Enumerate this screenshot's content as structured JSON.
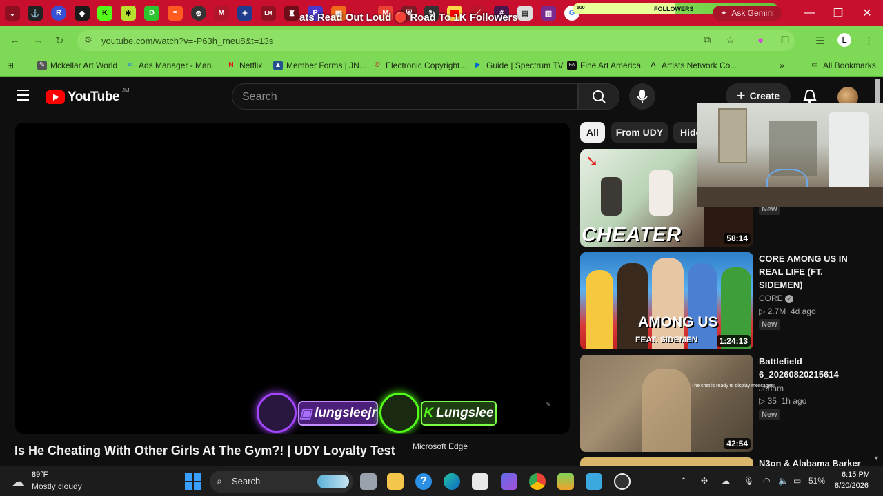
{
  "browser": {
    "overlay_title": "ats Read Out Loud 🔴 Road To 1K Followers",
    "followers_label": "FOLLOWERS",
    "followers_count": "500",
    "followers_progress": 0.5,
    "followers_small": "500",
    "ask_gemini": "Ask Gemini",
    "url": "youtube.com/watch?v=-P63h_rneu8&t=13s",
    "tab_icons": [
      "R",
      "K",
      "D",
      "M",
      "LM",
      "P",
      "M",
      "K"
    ]
  },
  "bookmarks": [
    {
      "label": "Mckellar Art World",
      "icon": "paint-icon"
    },
    {
      "label": "Ads Manager - Man...",
      "icon": "meta-icon"
    },
    {
      "label": "Netflix",
      "icon": "netflix-icon"
    },
    {
      "label": "Member Forms | JN...",
      "icon": "forms-icon"
    },
    {
      "label": "Electronic Copyright...",
      "icon": "copyright-icon"
    },
    {
      "label": "Guide | Spectrum TV",
      "icon": "play-icon"
    },
    {
      "label": "Fine Art America",
      "icon": "faa-icon"
    },
    {
      "label": "Artists Network Co...",
      "icon": "artists-icon"
    }
  ],
  "all_bookmarks": "All Bookmarks",
  "youtube": {
    "logo_text": "YouTube",
    "country": "JM",
    "search_placeholder": "Search",
    "create_label": "Create",
    "chips": [
      "All",
      "From UDY",
      "Hidde"
    ],
    "video_title": "Is He Cheating With Other Girls At The Gym?! | UDY Loyalty Test",
    "watermark_left": "lungsleejr",
    "watermark_right": "Lungslee",
    "recommendations": [
      {
        "thumb_text": "CHEATER",
        "duration": "58:14",
        "badge": "New"
      },
      {
        "title": "CORE AMONG US IN REAL LIFE (FT. SIDEMEN)",
        "channel": "CORE",
        "views": "2.7M",
        "age": "4d ago",
        "duration": "1:24:13",
        "thumb_text": "AMONG US",
        "thumb_sub": "FEAT. SIDEMEN",
        "badge": "New"
      },
      {
        "title": "Battlefield 6_20260820215614",
        "channel": "Jeriam",
        "views": "35",
        "age": "1h ago",
        "duration": "42:54",
        "chat_notice": "The chat is ready to display messages!",
        "badge": "New"
      },
      {
        "title": "N3on & Alabama Barker"
      }
    ]
  },
  "tooltip": "Microsoft Edge",
  "taskbar": {
    "temp": "89°F",
    "weather": "Mostly cloudy",
    "search": "Search",
    "battery": "51%",
    "time": "6:15 PM",
    "date": "8/20/2026"
  },
  "colors": {
    "tabstrip": "#c8102e",
    "toolbar": "#7ed957",
    "yt_bg": "#0f0f0f",
    "yt_red": "#ff0000"
  }
}
